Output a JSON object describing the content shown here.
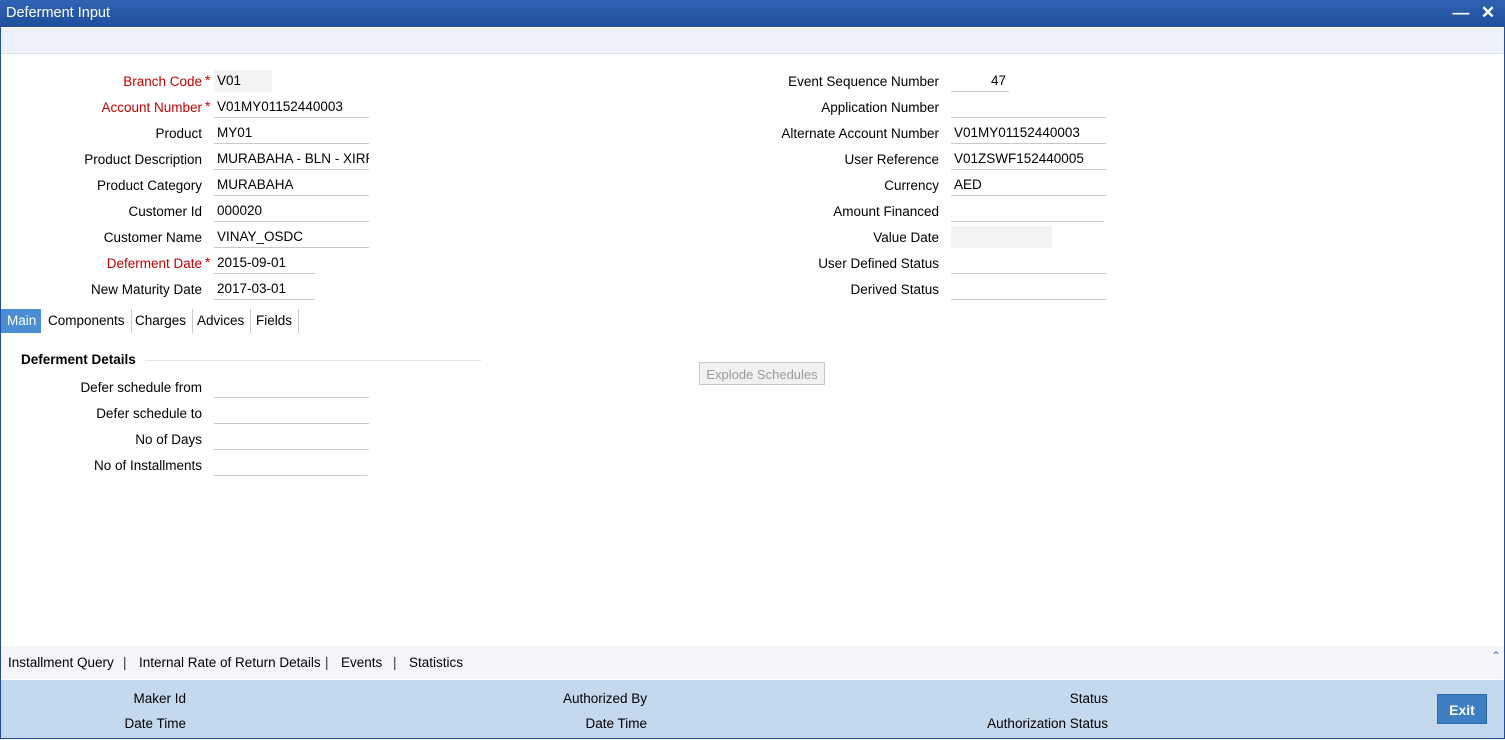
{
  "window": {
    "title": "Deferment Input",
    "minimize_icon": "minimize-icon",
    "close_icon": "close-icon"
  },
  "form": {
    "branch_code": {
      "label": "Branch Code",
      "value": "V01"
    },
    "account_number": {
      "label": "Account Number",
      "value": "V01MY01152440003"
    },
    "product": {
      "label": "Product",
      "value": "MY01"
    },
    "product_description": {
      "label": "Product Description",
      "value": "MURABAHA - BLN - XIRR"
    },
    "product_category": {
      "label": "Product Category",
      "value": "MURABAHA"
    },
    "customer_id": {
      "label": "Customer Id",
      "value": "000020"
    },
    "customer_name": {
      "label": "Customer Name",
      "value": "VINAY_OSDC"
    },
    "deferment_date": {
      "label": "Deferment Date",
      "value": "2015-09-01"
    },
    "new_maturity_date": {
      "label": "New Maturity Date",
      "value": "2017-03-01"
    },
    "event_sequence_number": {
      "label": "Event Sequence Number",
      "value": "47"
    },
    "application_number": {
      "label": "Application Number",
      "value": ""
    },
    "alternate_account_number": {
      "label": "Alternate Account Number",
      "value": "V01MY01152440003"
    },
    "user_reference": {
      "label": "User Reference",
      "value": "V01ZSWF152440005"
    },
    "currency": {
      "label": "Currency",
      "value": "AED"
    },
    "amount_financed": {
      "label": "Amount Financed",
      "value": ""
    },
    "value_date": {
      "label": "Value Date",
      "value": ""
    },
    "user_defined_status": {
      "label": "User Defined Status",
      "value": ""
    },
    "derived_status": {
      "label": "Derived Status",
      "value": ""
    },
    "required_mark": "*"
  },
  "tabs": [
    "Main",
    "Components",
    "Charges",
    "Advices",
    "Fields"
  ],
  "deferment": {
    "heading": "Deferment Details",
    "defer_from": {
      "label": "Defer schedule from",
      "value": ""
    },
    "defer_to": {
      "label": "Defer schedule to",
      "value": ""
    },
    "no_of_days": {
      "label": "No of Days",
      "value": ""
    },
    "no_of_installments": {
      "label": "No of Installments",
      "value": ""
    },
    "explode_button": "Explode Schedules"
  },
  "links": [
    "Installment Query",
    "Internal Rate of Return Details",
    "Events",
    "Statistics"
  ],
  "link_separator": "|",
  "footer": {
    "maker_id": "Maker Id",
    "maker_date_time": "Date Time",
    "authorized_by": "Authorized By",
    "auth_date_time": "Date Time",
    "status": "Status",
    "authorization_status": "Authorization Status",
    "exit_label": "Exit"
  },
  "colors": {
    "titlebar": "#1f4e9c",
    "active_tab": "#4a8dd2",
    "footer": "#c5d9ee",
    "required": "#c00000",
    "exit_button": "#3e7fc3"
  }
}
